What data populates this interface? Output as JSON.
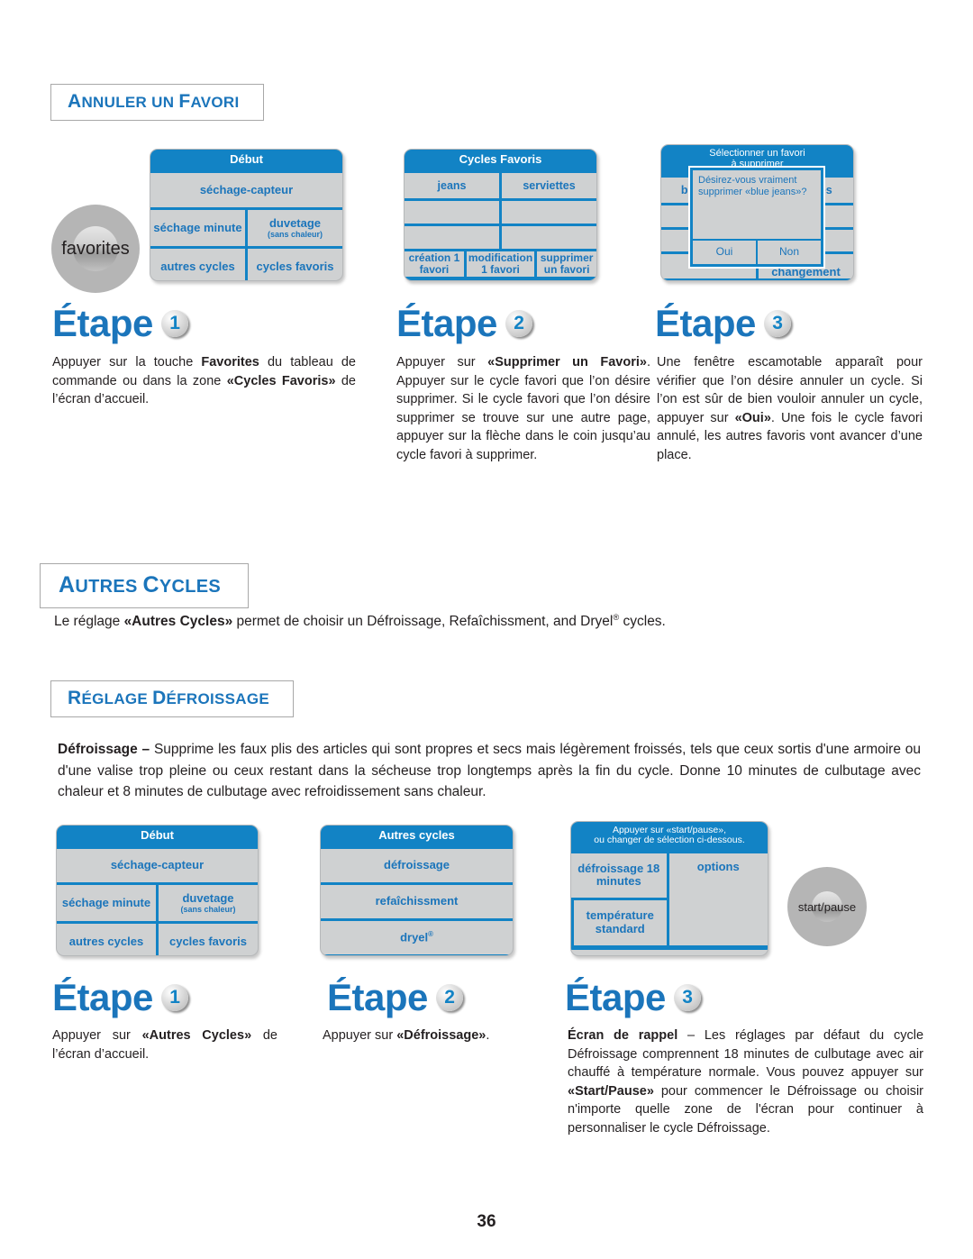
{
  "page": {
    "number": "36"
  },
  "sections": {
    "annuler": {
      "heading_a": "A",
      "heading_rest1": "NNULER UN ",
      "heading_b": "F",
      "heading_rest2": "AVORI"
    },
    "autres": {
      "heading_a": "A",
      "heading_rest1": "UTRES ",
      "heading_b": "C",
      "heading_rest2": "YCLES"
    },
    "reglage": {
      "heading_a": "R",
      "heading_rest1": "ÉGLAGE ",
      "heading_b": "D",
      "heading_rest2": "ÉFROISSAGE"
    }
  },
  "autres_intro": {
    "pre": "Le réglage ",
    "bold": "«Autres Cycles»",
    "post": " permet de choisir un Défroissage, Refaîchissment, and Dryel",
    "sup": "®",
    "tail": " cycles."
  },
  "defroissage_para": {
    "bold": "Défroissage – ",
    "text": "Supprime les faux plis des articles qui sont propres et secs mais légèrement froissés, tels que ceux sortis d'une armoire ou d'une valise trop pleine ou ceux restant dans la sécheuse trop longtemps après la fin du cycle. Donne 10 minutes de culbutage avec chaleur et 8 minutes de culbutage avec refroidissement sans chaleur."
  },
  "knobs": {
    "favorites": "favorites",
    "start_pause": "start/pause"
  },
  "screens": {
    "debut": {
      "title": "Début",
      "row1": "séchage-capteur",
      "row2_left": "séchage minute",
      "row2_right": "duvetage",
      "row2_right_sub": "(sans chaleur)",
      "row3_left": "autres cycles",
      "row3_right": "cycles favoris"
    },
    "cycles_favoris": {
      "title": "Cycles Favoris",
      "r1c1": "jeans",
      "r1c2": "serviettes",
      "r2c1": "",
      "r2c2": "",
      "r3c1": "",
      "r3c2": "",
      "f1": "création 1 favori",
      "f2": "modification 1 favori",
      "f3": "supprimer un favori"
    },
    "selectionner": {
      "title_line1": "Sélectionner un favori",
      "title_line2": "à supprimer",
      "r1c1": "blue jeans",
      "r1c2": "serviettes",
      "r2c1": "",
      "r2c2": "",
      "r3c1": "",
      "r3c2": "",
      "f1": "",
      "f2": "sans changement",
      "dialog": {
        "message_l1": "Désirez-vous vraiment",
        "message_l2": "supprimer «blue jeans»?",
        "yes": "Oui",
        "no": "Non"
      }
    },
    "autres_cycles": {
      "title": "Autres cycles",
      "r1": "défroissage",
      "r2": "refaîchissment",
      "r3": "dryel",
      "r3_sup": "®"
    },
    "rappel": {
      "title_line1": "Appuyer sur «start/pause»,",
      "title_line2": "ou changer de sélection ci-dessous.",
      "left_top": "défroissage 18 minutes",
      "left_bottom": "température standard",
      "right": "options"
    }
  },
  "steps": {
    "top": [
      {
        "label": "Étape",
        "num": "1"
      },
      {
        "label": "Étape",
        "num": "2"
      },
      {
        "label": "Étape",
        "num": "3"
      }
    ],
    "bottom": [
      {
        "label": "Étape",
        "num": "1"
      },
      {
        "label": "Étape",
        "num": "2"
      },
      {
        "label": "Étape",
        "num": "3"
      }
    ]
  },
  "body": {
    "top1_a": "Appuyer sur la touche ",
    "top1_b1": "Favorites",
    "top1_c": " du tableau de commande ou dans la zone ",
    "top1_b2": "«Cycles Favoris»",
    "top1_d": " de l’écran d’accueil.",
    "top2_a": "Appuyer sur ",
    "top2_b1": "«Supprimer un Favori»",
    "top2_c": ". Appuyer sur le cycle favori que l’on désire supprimer. Si le cycle favori que l’on désire supprimer se trouve sur une autre page, appuyer sur la flèche dans le coin jusqu’au cycle favori à supprimer.",
    "top3_a": "Une fenêtre escamotable apparaît pour vérifier que l’on désire annuler un cycle. Si l’on est sûr de bien vouloir annuler un cycle, appuyer sur ",
    "top3_b1": "«Oui»",
    "top3_c": ". Une fois le cycle favori annulé, les autres favoris vont avancer d’une place.",
    "bot1_a": "Appuyer sur ",
    "bot1_b1": "«Autres Cycles»",
    "bot1_c": " de l’écran d’accueil.",
    "bot2_a": "Appuyer sur ",
    "bot2_b1": "«Défroissage»",
    "bot2_c": ".",
    "bot3_b1": "Écran de rappel",
    "bot3_a": " – Les réglages par défaut du cycle Défroissage comprennent 18 minutes de culbutage avec air chauffé à température normale. Vous pouvez appuyer sur ",
    "bot3_b2": "«Start/Pause»",
    "bot3_c": " pour commencer le Défroissage ou choisir n'importe quelle zone de l'écran pour continuer à personnaliser le cycle Défroissage."
  }
}
